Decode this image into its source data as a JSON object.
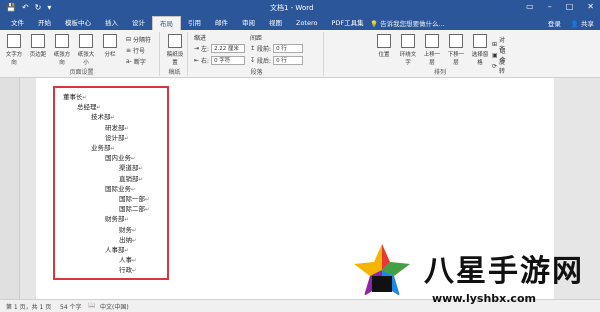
{
  "window": {
    "title": "文档1 - Word"
  },
  "tabs": [
    "文件",
    "开始",
    "模板中心",
    "插入",
    "设计",
    "布局",
    "引用",
    "邮件",
    "审阅",
    "视图",
    "Zotero",
    "PDF工具集"
  ],
  "active_tab": "布局",
  "tellme": "告诉我您想要做什么...",
  "account": {
    "login": "登录",
    "share": "共享"
  },
  "ribbon": {
    "page_setup": {
      "label": "页面设置",
      "btns": [
        "文字方向",
        "页边距",
        "纸张方向",
        "纸张大小",
        "分栏"
      ],
      "breaks": "分隔符",
      "line_numbers": "行号",
      "hyphenation": "断字"
    },
    "draft": {
      "label": "稿纸",
      "btn": "稿纸设置"
    },
    "paragraph": {
      "label": "段落",
      "indent": "缩进",
      "spacing": "间距",
      "left": "左:",
      "right": "右:",
      "before": "段前:",
      "after": "段后:",
      "left_val": "2.22 厘米",
      "right_val": "0 字符",
      "before_val": "0 行",
      "after_val": "0 行"
    },
    "arrange": {
      "label": "排列",
      "btns": [
        "位置",
        "环绕文字",
        "上移一层",
        "下移一层",
        "选择窗格"
      ],
      "align": "对齐",
      "group": "组合",
      "rotate": "旋转"
    }
  },
  "outline": [
    {
      "text": "董事长",
      "level": 0
    },
    {
      "text": "总经理",
      "level": 1
    },
    {
      "text": "技术部",
      "level": 2
    },
    {
      "text": "研发部",
      "level": 3
    },
    {
      "text": "设计部",
      "level": 3
    },
    {
      "text": "业务部",
      "level": 2
    },
    {
      "text": "国内业务",
      "level": 3
    },
    {
      "text": "渠道部",
      "level": 4
    },
    {
      "text": "直销部",
      "level": 4
    },
    {
      "text": "国际业务",
      "level": 3
    },
    {
      "text": "国际一部",
      "level": 4
    },
    {
      "text": "国际二部",
      "level": 4
    },
    {
      "text": "财务部",
      "level": 3
    },
    {
      "text": "财务",
      "level": 4
    },
    {
      "text": "出纳",
      "level": 4
    },
    {
      "text": "人事部",
      "level": 3
    },
    {
      "text": "人事",
      "level": 4
    },
    {
      "text": "行政",
      "level": 4
    }
  ],
  "status": {
    "page": "第 1 页，共 1 页",
    "words": "54 个字",
    "lang": "中文(中国)"
  },
  "watermark": {
    "text": "八星手游网",
    "url": "www.lyshbx.com"
  },
  "colors": {
    "accent": "#2b579a",
    "highlight": "#d9363e"
  }
}
